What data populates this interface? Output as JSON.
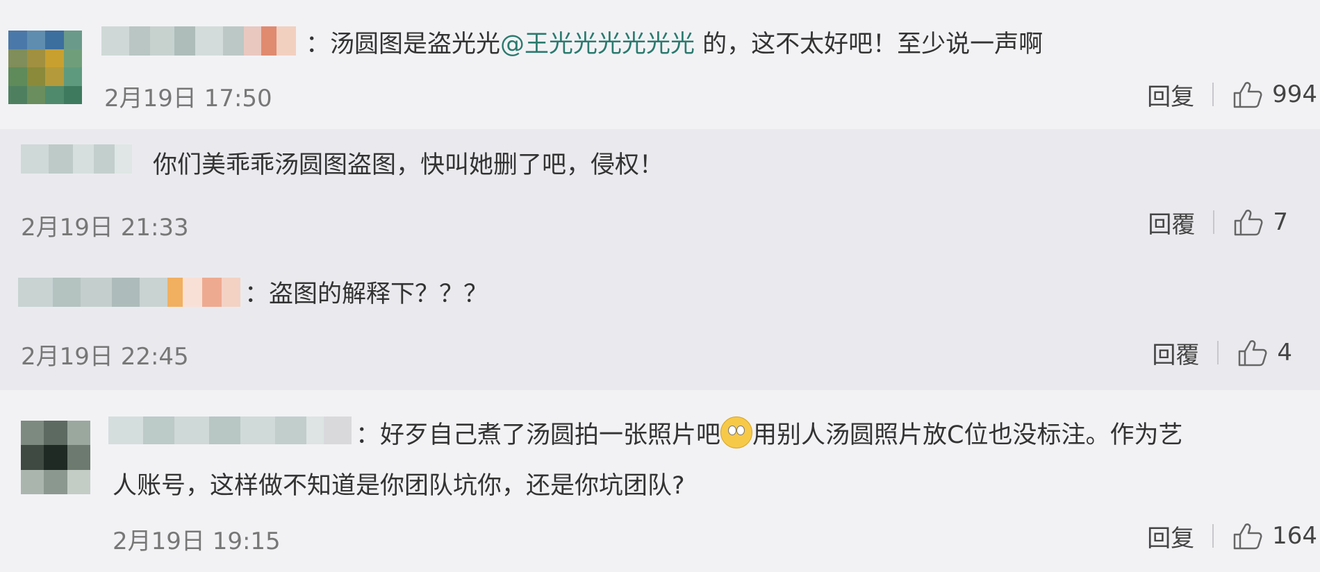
{
  "comments": [
    {
      "prefix": "：汤圆图是盗光光",
      "mention": "@王光光光光光光",
      "suffix": " 的，这不太好吧！至少说一声啊",
      "time": "2月19日 17:50",
      "reply_label": "回复",
      "likes": "994"
    },
    {
      "text": "你们美乖乖汤圆图盗图，快叫她删了吧，侵权！",
      "time": "2月19日 21:33",
      "reply_label": "回覆",
      "likes": "7"
    },
    {
      "text": "：盗图的解释下？？？",
      "time": "2月19日 22:45",
      "reply_label": "回覆",
      "likes": "4"
    },
    {
      "text_part1": "：好歹自己煮了汤圆拍一张照片吧",
      "emoji": "eye-roll-emoji",
      "text_part2": "用别人汤圆照片放C位也没标注。作为艺",
      "text_line2": "人账号，这样做不知道是你团队坑你，还是你坑团队?",
      "time": "2月19日 19:15",
      "reply_label": "回复",
      "likes": "164"
    }
  ],
  "colors": {
    "background": "#f2f2f5",
    "reply_background": "#eaeaee",
    "mention": "#2b7a6e"
  }
}
